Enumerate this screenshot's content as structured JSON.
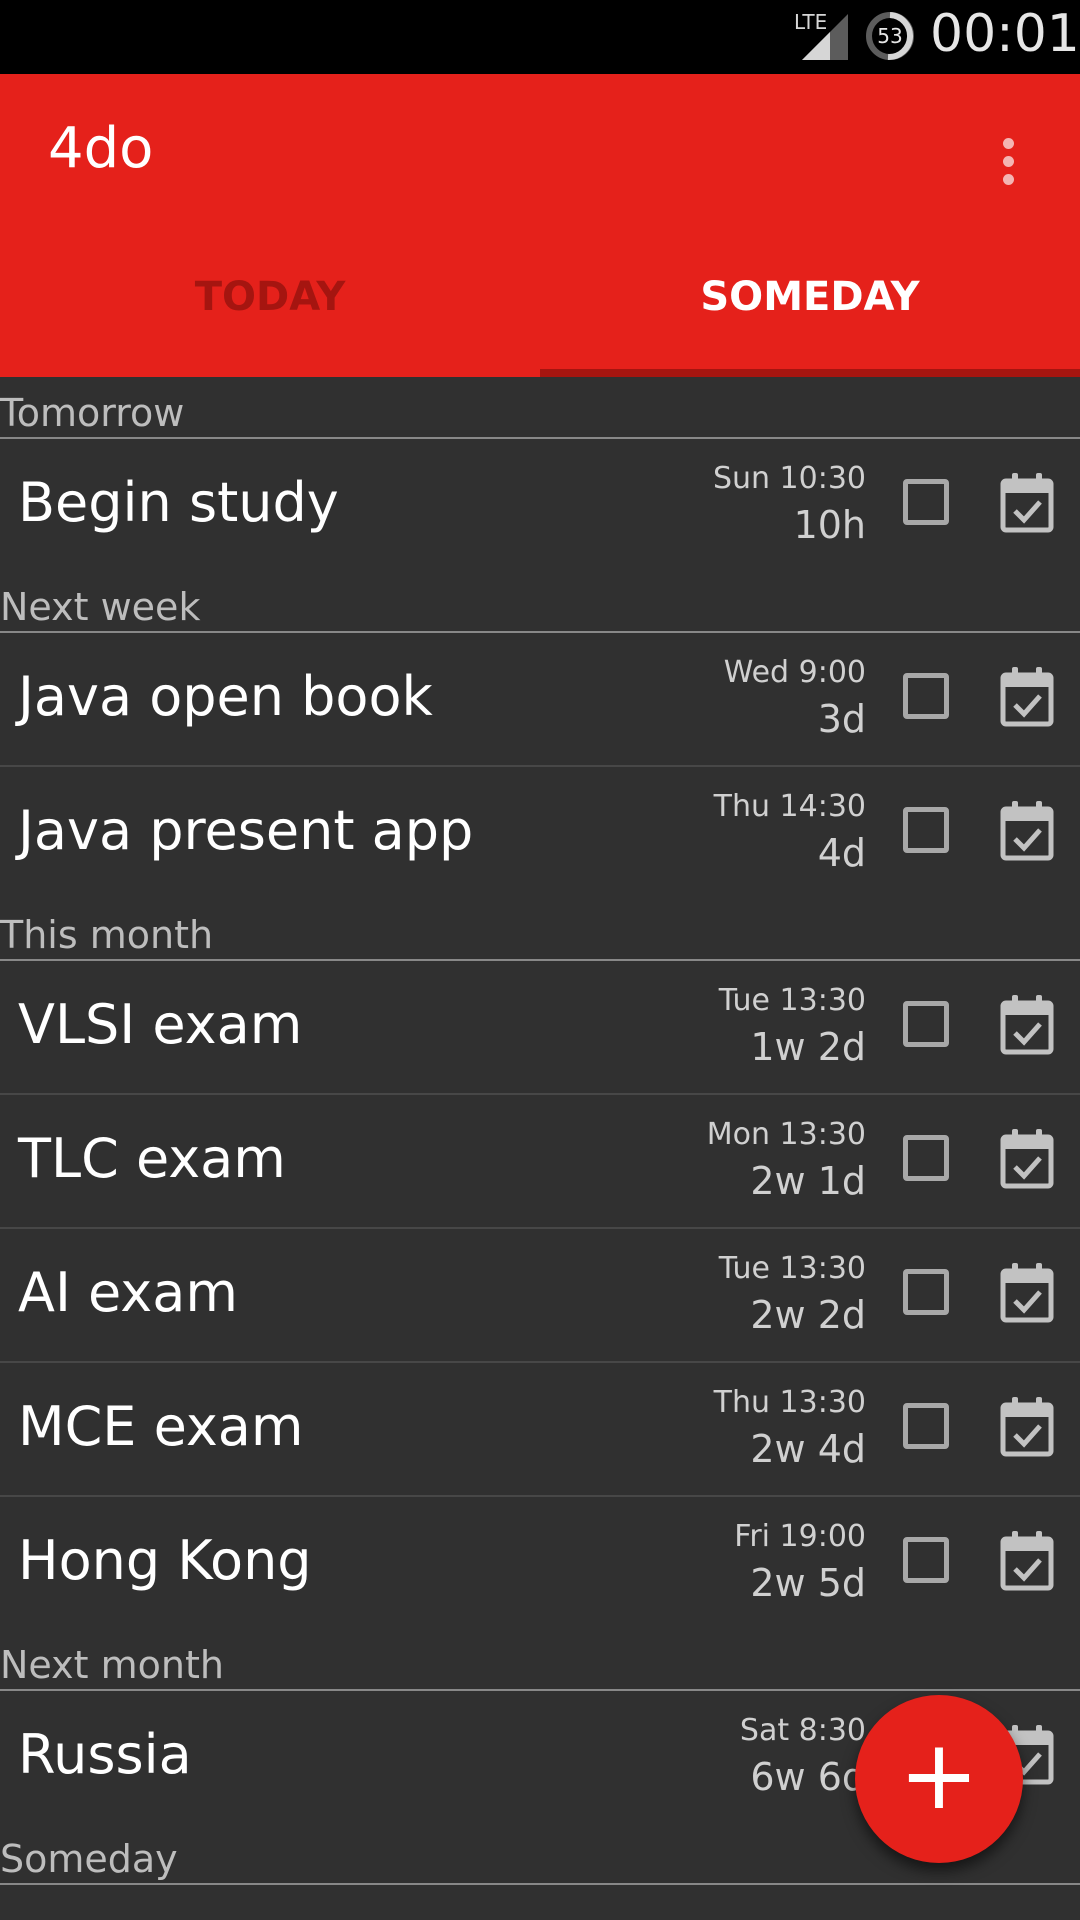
{
  "status_bar": {
    "network": "LTE",
    "battery": "53",
    "time": "00:01"
  },
  "app": {
    "title": "4do"
  },
  "tabs": [
    {
      "label": "TODAY",
      "selected": false
    },
    {
      "label": "SOMEDAY",
      "selected": true
    }
  ],
  "sections": [
    {
      "header": "Tomorrow",
      "tasks": [
        {
          "title": "Begin study",
          "date": "Sun 10:30",
          "remaining": "10h"
        }
      ]
    },
    {
      "header": "Next week",
      "tasks": [
        {
          "title": "Java open book",
          "date": "Wed 9:00",
          "remaining": "3d"
        },
        {
          "title": "Java present app",
          "date": "Thu 14:30",
          "remaining": "4d"
        }
      ]
    },
    {
      "header": "This month",
      "tasks": [
        {
          "title": "VLSI exam",
          "date": "Tue 13:30",
          "remaining": "1w 2d"
        },
        {
          "title": "TLC exam",
          "date": "Mon 13:30",
          "remaining": "2w 1d"
        },
        {
          "title": "AI exam",
          "date": "Tue 13:30",
          "remaining": "2w 2d"
        },
        {
          "title": "MCE exam",
          "date": "Thu 13:30",
          "remaining": "2w 4d"
        },
        {
          "title": "Hong Kong",
          "date": "Fri 19:00",
          "remaining": "2w 5d"
        }
      ]
    },
    {
      "header": "Next month",
      "tasks": [
        {
          "title": "Russia",
          "date": "Sat 8:30",
          "remaining": "6w 6d"
        }
      ]
    },
    {
      "header": "Someday",
      "tasks": []
    }
  ],
  "fab": {
    "label": "+"
  },
  "colors": {
    "primary": "#e5211b",
    "tab_inactive": "#a51510",
    "background": "#303030"
  }
}
